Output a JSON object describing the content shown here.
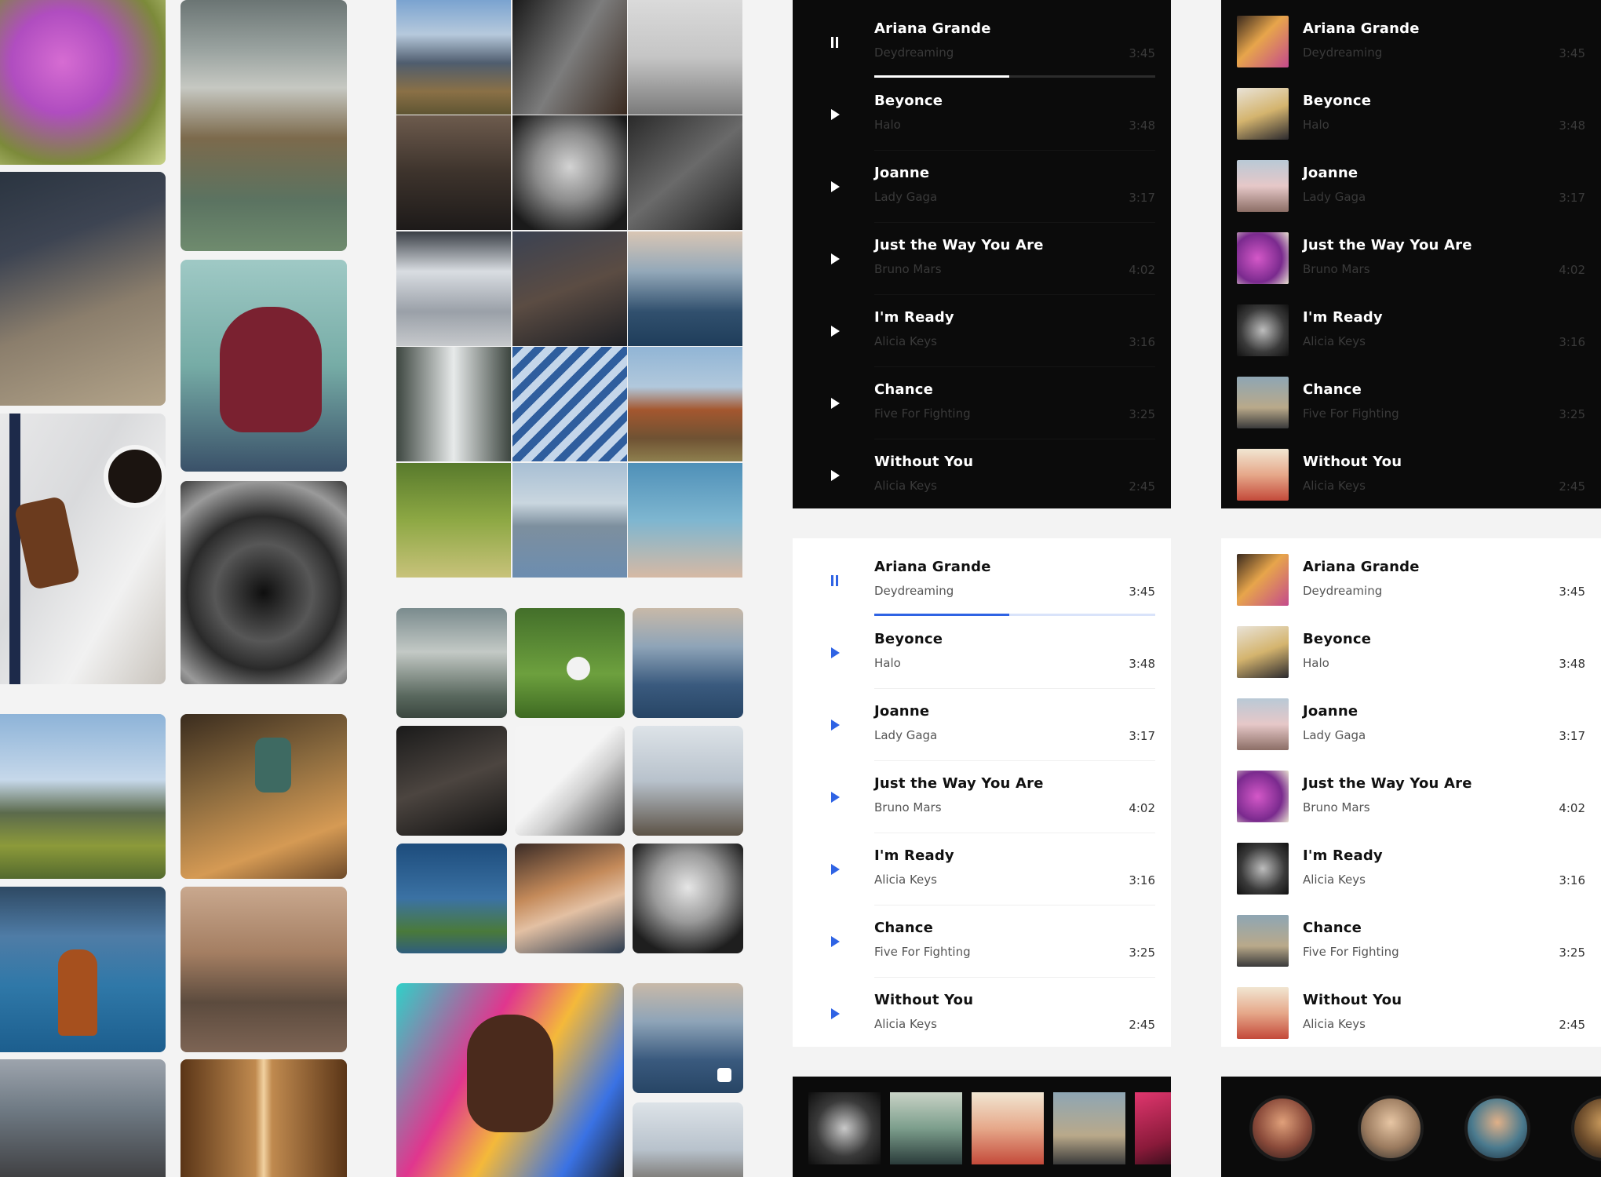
{
  "colors": {
    "dark_bg": "#0b0b0b",
    "light_bg": "#ffffff",
    "accent_blue": "#2f63e4",
    "page_bg": "#f3f3f3"
  },
  "playlist": {
    "tracks": [
      {
        "title": "Ariana Grande",
        "artist": "Deydreaming",
        "duration": "3:45",
        "state": "playing",
        "progress": 0.48
      },
      {
        "title": "Beyonce",
        "artist": "Halo",
        "duration": "3:48",
        "state": "paused"
      },
      {
        "title": "Joanne",
        "artist": "Lady Gaga",
        "duration": "3:17",
        "state": "paused"
      },
      {
        "title": "Just the Way You Are",
        "artist": "Bruno Mars",
        "duration": "4:02",
        "state": "paused"
      },
      {
        "title": "I'm Ready",
        "artist": "Alicia Keys",
        "duration": "3:16",
        "state": "paused"
      },
      {
        "title": "Chance",
        "artist": "Five For Fighting",
        "duration": "3:25",
        "state": "paused"
      },
      {
        "title": "Without You",
        "artist": "Alicia Keys",
        "duration": "2:45",
        "state": "paused"
      }
    ]
  },
  "icons": {
    "play": "play-icon",
    "pause": "pause-icon"
  }
}
